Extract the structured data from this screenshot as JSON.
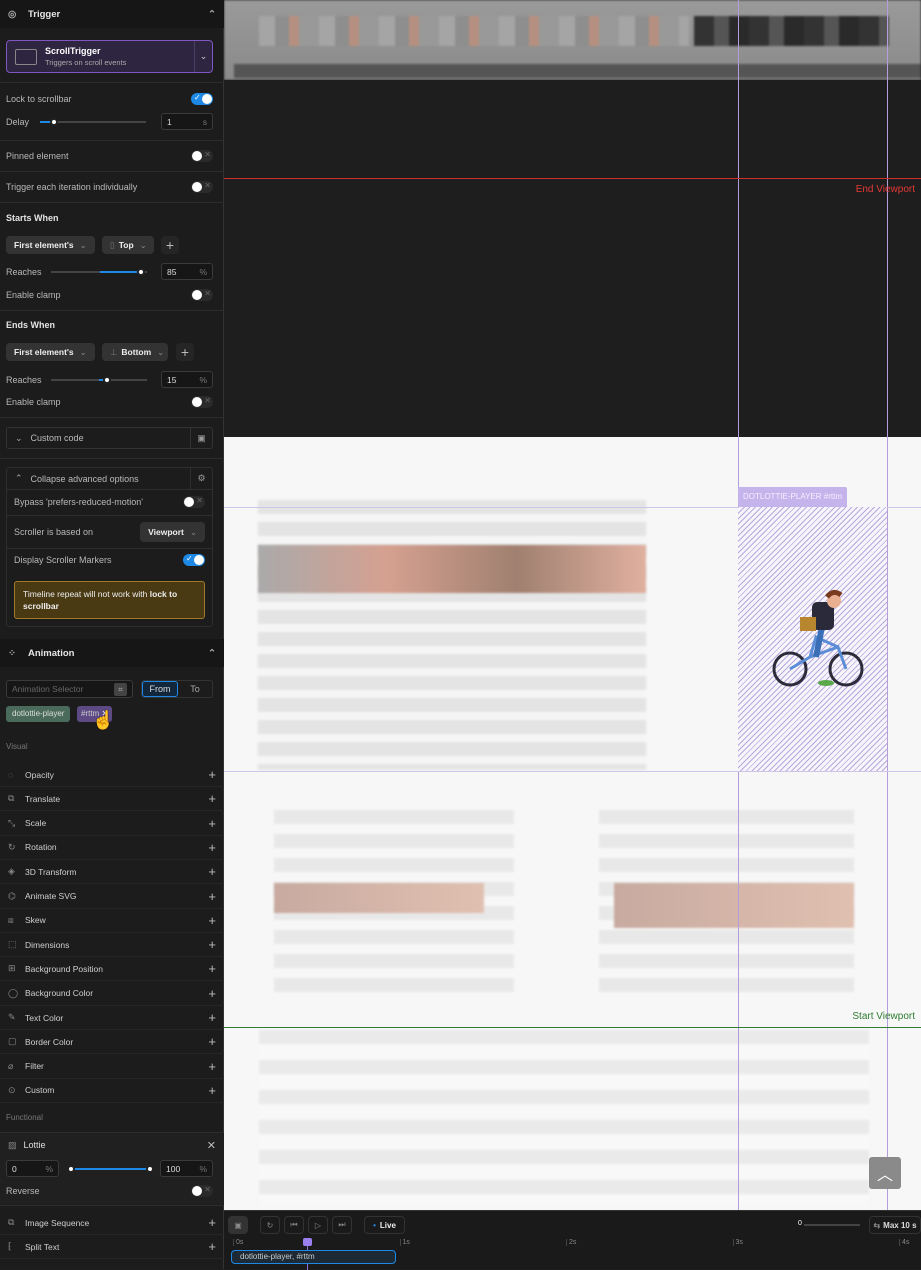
{
  "trigger": {
    "title": "Trigger",
    "type_name": "ScrollTrigger",
    "type_desc": "Triggers on scroll events",
    "lock_label": "Lock to scrollbar",
    "lock_on": true,
    "delay_label": "Delay",
    "delay_value": "1",
    "delay_unit": "s",
    "pinned_label": "Pinned element",
    "pinned_on": false,
    "each_iter_label": "Trigger each iteration individually",
    "each_iter_on": false
  },
  "starts": {
    "title": "Starts When",
    "element": "First element's",
    "edge": "Top",
    "reaches_label": "Reaches",
    "reaches_value": "85",
    "unit": "%",
    "clamp_label": "Enable clamp",
    "clamp_on": false
  },
  "ends": {
    "title": "Ends When",
    "element": "First element's",
    "edge": "Bottom",
    "reaches_label": "Reaches",
    "reaches_value": "15",
    "unit": "%",
    "clamp_label": "Enable clamp",
    "clamp_on": false
  },
  "custom_code": "Custom code",
  "advanced": {
    "title": "Collapse advanced options",
    "bypass_label": "Bypass 'prefers-reduced-motion'",
    "bypass_on": false,
    "scroller_label": "Scroller is based on",
    "scroller_value": "Viewport",
    "markers_label": "Display Scroller Markers",
    "markers_on": true,
    "warning_pre": "Timeline repeat will not work with ",
    "warning_bold1": "lock to",
    "warning_bold2": "scrollbar"
  },
  "animation": {
    "title": "Animation",
    "selector_placeholder": "Animation Selector",
    "from": "From",
    "to": "To",
    "tags": [
      "dotlottie-player",
      "#rttm"
    ],
    "visual_label": "Visual",
    "visual": [
      "Opacity",
      "Translate",
      "Scale",
      "Rotation",
      "3D Transform",
      "Animate SVG",
      "Skew",
      "Dimensions",
      "Background Position",
      "Background Color",
      "Text Color",
      "Border Color",
      "Filter",
      "Custom"
    ],
    "functional_label": "Functional",
    "lottie": {
      "label": "Lottie",
      "start": "0",
      "end": "100",
      "unit": "%",
      "reverse_label": "Reverse",
      "reverse_on": false
    },
    "functional": [
      "Image Sequence",
      "Split Text"
    ]
  },
  "canvas": {
    "end_marker": "End Viewport",
    "start_marker": "Start Viewport",
    "element_label": "DOTLOTTIE-PLAYER #rttm",
    "end_color": "#d32f2f",
    "start_color": "#2e7d32",
    "accent": "#b39ddb"
  },
  "timeline": {
    "live": "Live",
    "max": "Max 10 s",
    "zoom_value": "0",
    "ticks": [
      "0s",
      "1s",
      "2s",
      "3s",
      "4s"
    ],
    "clip": "dotlottie-player, #rttm"
  }
}
